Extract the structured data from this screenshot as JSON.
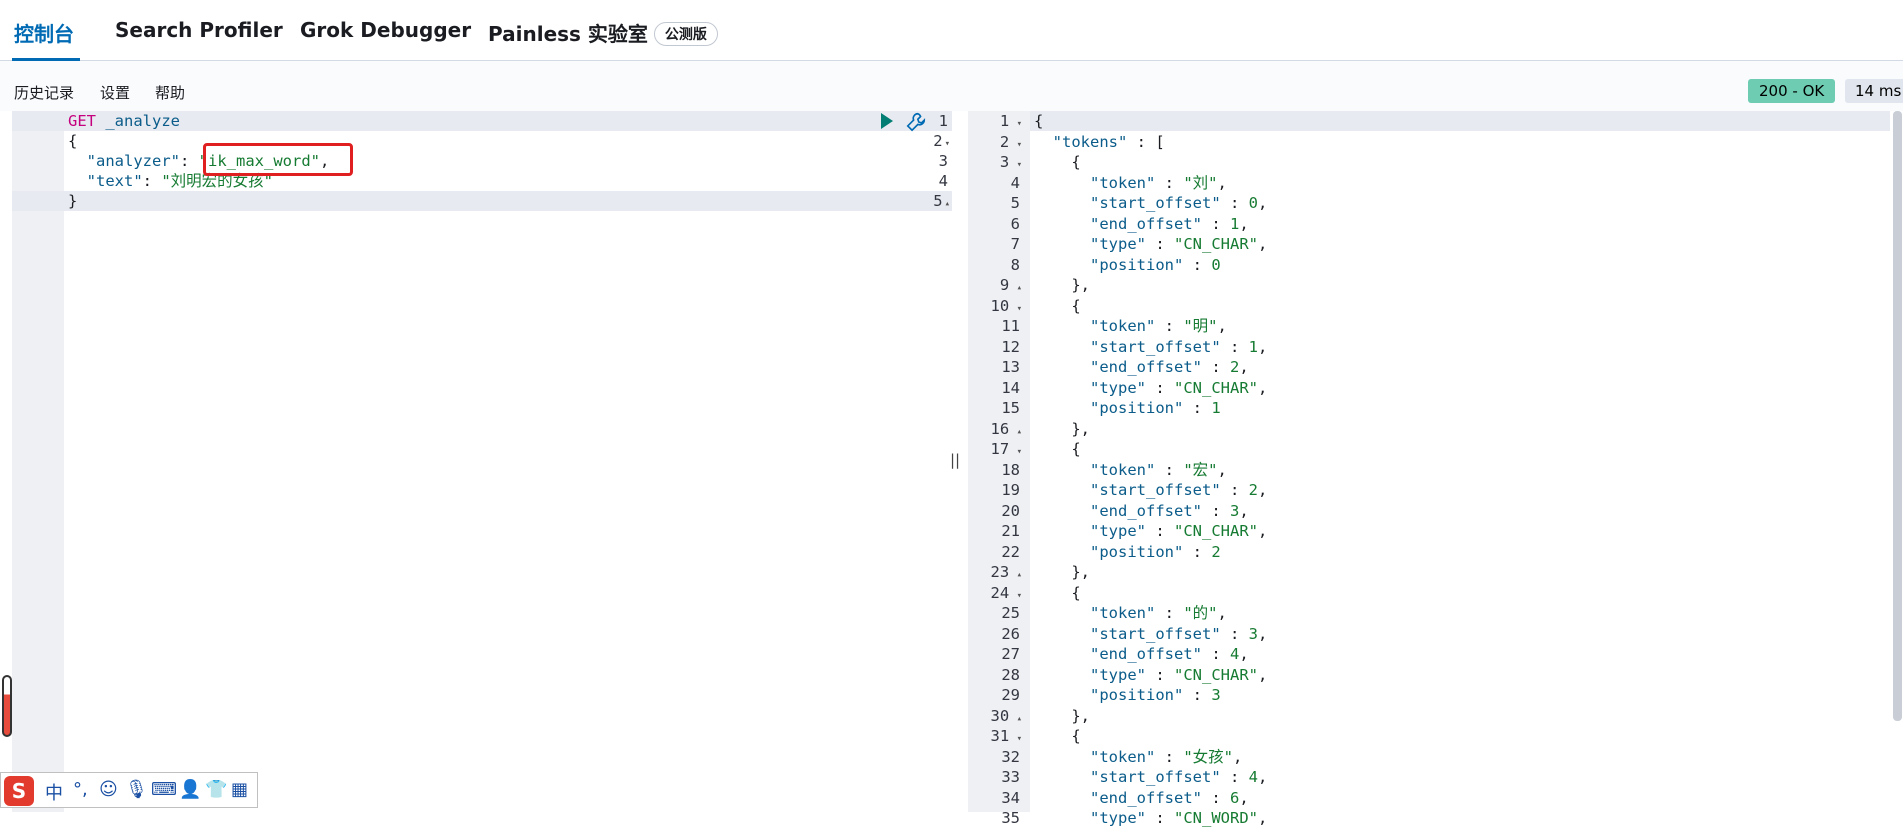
{
  "tabs": [
    {
      "label": "控制台",
      "active": true
    },
    {
      "label": "Search Profiler"
    },
    {
      "label": "Grok Debugger"
    },
    {
      "label": "Painless 实验室",
      "badge": "公测版"
    }
  ],
  "toolbar": {
    "history": "历史记录",
    "settings": "设置",
    "help": "帮助"
  },
  "response_meta": {
    "status": "200 - OK",
    "status_color": "#6dccb1",
    "time": "14 ms"
  },
  "request": {
    "method": "GET",
    "endpoint": "_analyze",
    "analyzer_key": "\"analyzer\"",
    "analyzer_value": "\"ik_max_word\"",
    "text_key": "\"text\"",
    "text_value": "\"刘明宏的女孩\""
  },
  "response_lines": [
    "{",
    "  \"tokens\" : [",
    "    {",
    "      \"token\" : \"刘\",",
    "      \"start_offset\" : 0,",
    "      \"end_offset\" : 1,",
    "      \"type\" : \"CN_CHAR\",",
    "      \"position\" : 0",
    "    },",
    "    {",
    "      \"token\" : \"明\",",
    "      \"start_offset\" : 1,",
    "      \"end_offset\" : 2,",
    "      \"type\" : \"CN_CHAR\",",
    "      \"position\" : 1",
    "    },",
    "    {",
    "      \"token\" : \"宏\",",
    "      \"start_offset\" : 2,",
    "      \"end_offset\" : 3,",
    "      \"type\" : \"CN_CHAR\",",
    "      \"position\" : 2",
    "    },",
    "    {",
    "      \"token\" : \"的\",",
    "      \"start_offset\" : 3,",
    "      \"end_offset\" : 4,",
    "      \"type\" : \"CN_CHAR\",",
    "      \"position\" : 3",
    "    },",
    "    {",
    "      \"token\" : \"女孩\",",
    "      \"start_offset\" : 4,",
    "      \"end_offset\" : 6,",
    "      \"type\" : \"CN_WORD\","
  ],
  "ime": {
    "logo": "S",
    "mode": "中",
    "punct": "°,",
    "icons": [
      "emoji-icon",
      "microphone-icon",
      "keyboard-icon",
      "user-icon",
      "shirt-icon",
      "grid-icon"
    ]
  },
  "divider": "||"
}
